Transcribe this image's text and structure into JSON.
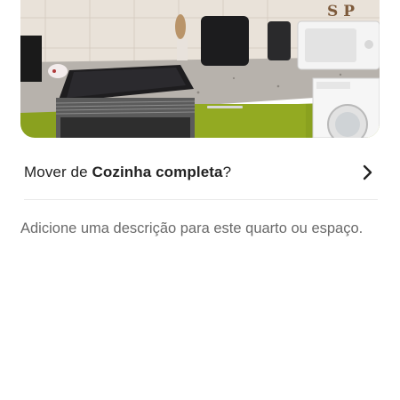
{
  "photo": {
    "alt_label": "kitchen-photo"
  },
  "move_row": {
    "prefix": "Mover de ",
    "room": "Cozinha completa",
    "suffix": "?",
    "icon": "chevron-right-icon"
  },
  "description": {
    "placeholder": "Adicione uma descrição para este quarto ou espaço."
  },
  "colors": {
    "text_primary": "#222222",
    "text_secondary": "#6a6a6a",
    "divider": "#ebebeb",
    "cabinet_green": "#8aa11f"
  }
}
